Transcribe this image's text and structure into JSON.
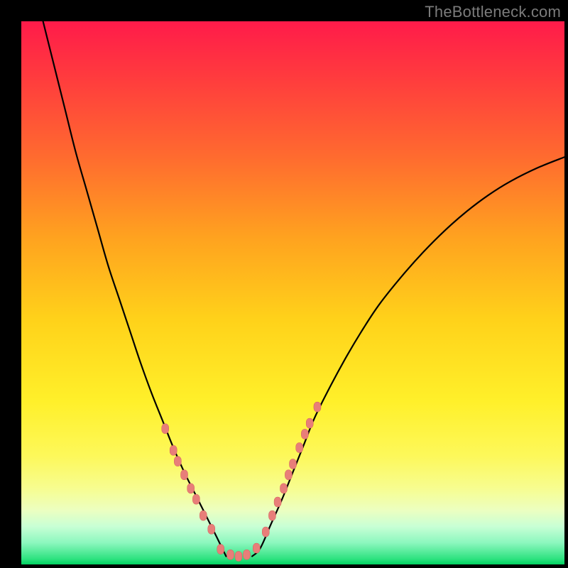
{
  "watermark": "TheBottleneck.com",
  "colors": {
    "background": "#000000",
    "gradient_top": "#ff1b4a",
    "gradient_bottom": "#00d060",
    "curve_stroke": "#000000",
    "marker_fill": "#e87e79",
    "marker_stroke": "#d25f5a"
  },
  "chart_data": {
    "type": "line",
    "title": "",
    "xlabel": "",
    "ylabel": "",
    "xlim": [
      0,
      100
    ],
    "ylim": [
      0,
      100
    ],
    "left_curve": {
      "x": [
        4,
        6,
        8,
        10,
        12,
        14,
        16,
        18,
        20,
        22,
        24,
        26,
        28,
        30,
        32,
        34,
        36,
        37.7
      ],
      "y": [
        100,
        92,
        84,
        76,
        69,
        62,
        55,
        49,
        43,
        37,
        31.5,
        26.5,
        21.5,
        17,
        13,
        9,
        5,
        1.5
      ]
    },
    "right_curve": {
      "x": [
        42.5,
        44,
        46,
        48,
        50,
        52,
        54,
        57,
        60,
        63,
        66,
        70,
        74,
        78,
        82,
        86,
        90,
        95,
        100
      ],
      "y": [
        1.5,
        3,
        7.5,
        12,
        17,
        22,
        27,
        33,
        38.5,
        43.5,
        48,
        53,
        57.5,
        61.5,
        65,
        68,
        70.5,
        73,
        75
      ]
    },
    "markers_left": [
      {
        "x": 26.5,
        "y": 25
      },
      {
        "x": 28.0,
        "y": 21
      },
      {
        "x": 28.8,
        "y": 19
      },
      {
        "x": 30.0,
        "y": 16.5
      },
      {
        "x": 31.2,
        "y": 14
      },
      {
        "x": 32.2,
        "y": 12
      },
      {
        "x": 33.5,
        "y": 9
      },
      {
        "x": 35.0,
        "y": 6.5
      }
    ],
    "markers_right": [
      {
        "x": 45.0,
        "y": 6
      },
      {
        "x": 46.2,
        "y": 9
      },
      {
        "x": 47.2,
        "y": 11.5
      },
      {
        "x": 48.3,
        "y": 14
      },
      {
        "x": 49.2,
        "y": 16.5
      },
      {
        "x": 50.0,
        "y": 18.5
      },
      {
        "x": 51.2,
        "y": 21.5
      },
      {
        "x": 52.2,
        "y": 24
      },
      {
        "x": 53.1,
        "y": 26
      },
      {
        "x": 54.5,
        "y": 29
      }
    ],
    "markers_bottom": [
      {
        "x": 36.7,
        "y": 2.8
      },
      {
        "x": 38.5,
        "y": 1.8
      },
      {
        "x": 40.0,
        "y": 1.5
      },
      {
        "x": 41.5,
        "y": 1.8
      },
      {
        "x": 43.3,
        "y": 3.0
      }
    ]
  }
}
